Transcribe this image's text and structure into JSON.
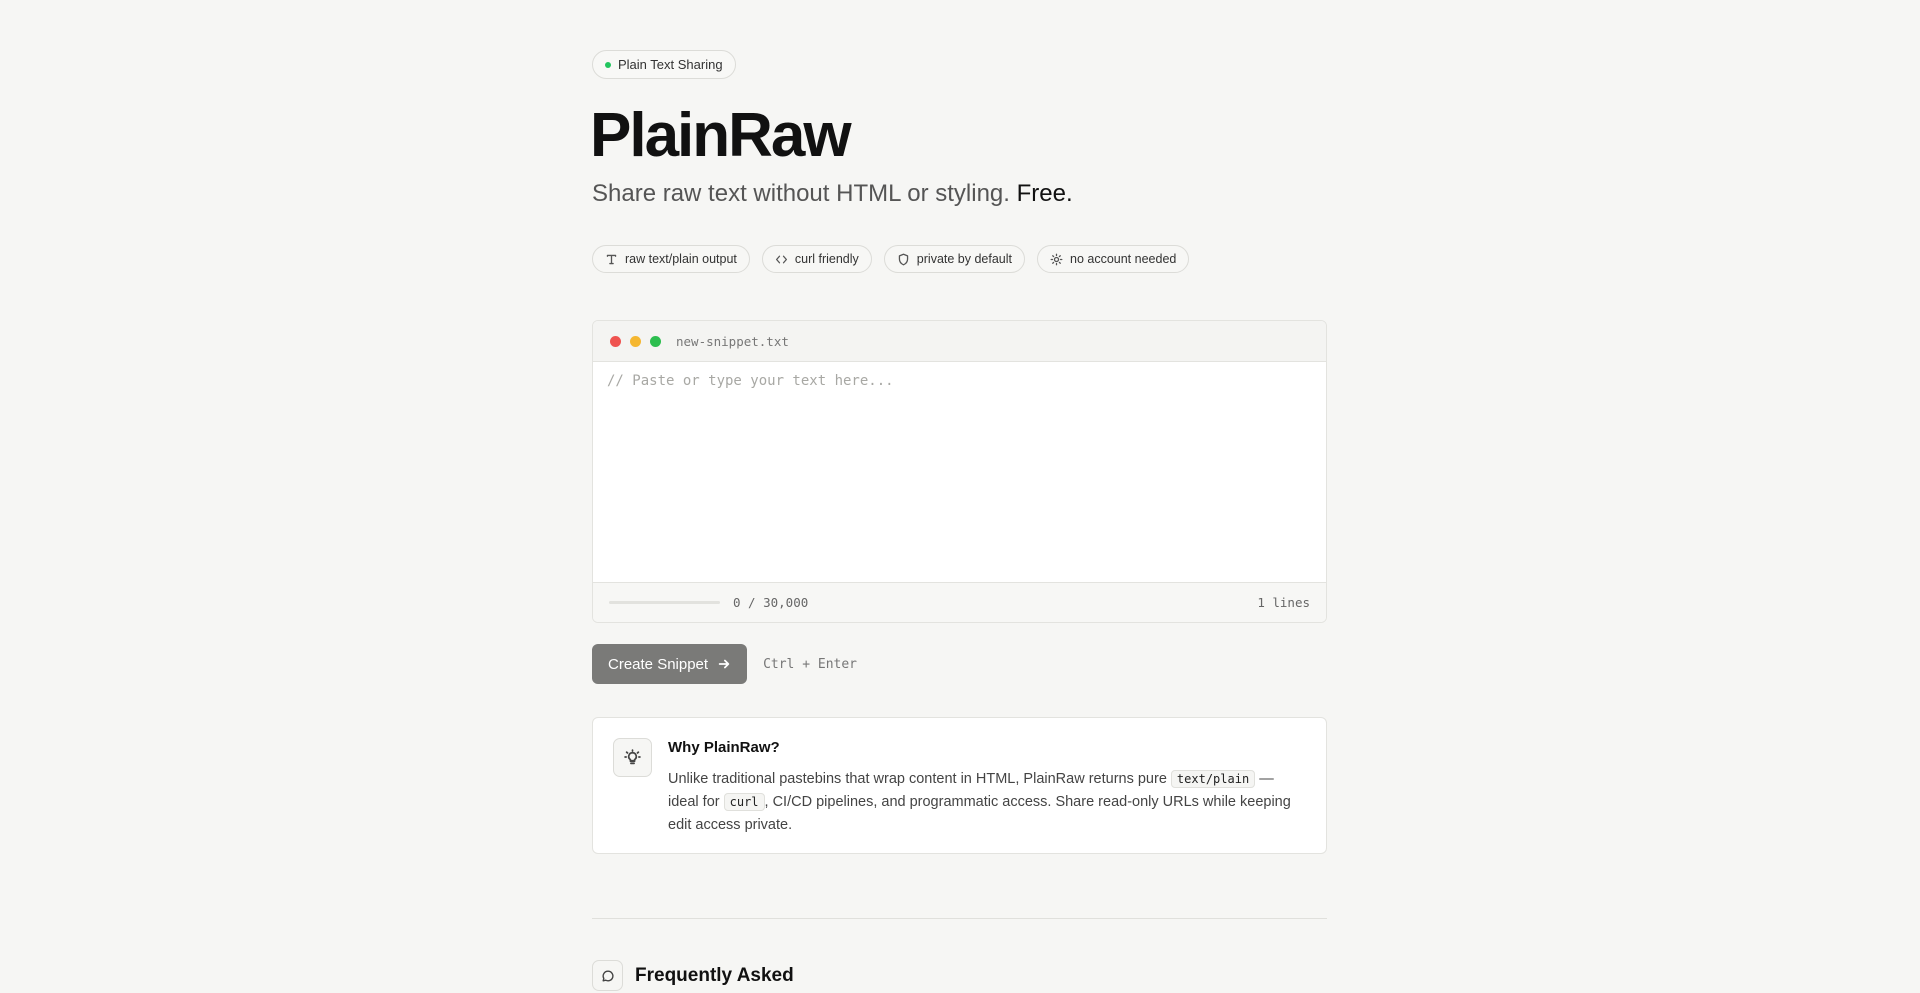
{
  "header": {
    "badge_label": "Plain Text Sharing",
    "badge_dot_color": "#22c55e",
    "title": "PlainRaw",
    "subtitle_main": "Share raw text without HTML or styling.",
    "subtitle_emphasis": "Free."
  },
  "features": [
    {
      "icon": "type-icon",
      "label": "raw text/plain output"
    },
    {
      "icon": "code-icon",
      "label": "curl friendly"
    },
    {
      "icon": "shield-icon",
      "label": "private by default"
    },
    {
      "icon": "sun-icon",
      "label": "no account needed"
    }
  ],
  "editor": {
    "filename": "new-snippet.txt",
    "placeholder": "// Paste or type your text here...",
    "value": "",
    "char_count": "0 / 30,000",
    "char_progress": 0,
    "line_count": "1 lines",
    "traffic_colors": [
      "#ef5350",
      "#f5b731",
      "#2dbe4f"
    ]
  },
  "actions": {
    "create_label": "Create Snippet",
    "shortcut": "Ctrl + Enter"
  },
  "info": {
    "icon": "lightbulb-icon",
    "title": "Why PlainRaw?",
    "text_part1": "Unlike traditional pastebins that wrap content in HTML, PlainRaw returns pure",
    "code1": "text/plain",
    "text_part2": "— ideal for",
    "code2": "curl",
    "text_part3": ", CI/CD pipelines, and programmatic access. Share read-only URLs while keeping edit access private."
  },
  "faq": {
    "icon": "message-circle-icon",
    "title": "Frequently Asked"
  }
}
